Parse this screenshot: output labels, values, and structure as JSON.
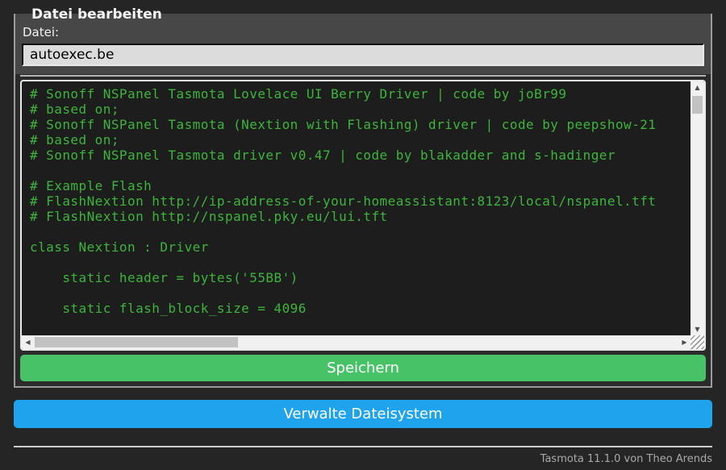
{
  "panel": {
    "legend": "Datei bearbeiten",
    "file_label": "Datei:",
    "file_value": "autoexec.be",
    "save_button": "Speichern"
  },
  "code_editor": {
    "text": "# Sonoff NSPanel Tasmota Lovelace UI Berry Driver | code by joBr99\n# based on;\n# Sonoff NSPanel Tasmota (Nextion with Flashing) driver | code by peepshow-21\n# based on;\n# Sonoff NSPanel Tasmota driver v0.47 | code by blakadder and s-hadinger\n\n# Example Flash\n# FlashNextion http://ip-address-of-your-homeassistant:8123/local/nspanel.tft\n# FlashNextion http://nspanel.pky.eu/lui.tft\n\nclass Nextion : Driver\n\n    static header = bytes('55BB')\n\n    static flash_block_size = 4096",
    "text_color": "#3db53c",
    "background": "#1d1d1d"
  },
  "icons": {
    "scroll_up": "▲",
    "scroll_down": "▼",
    "scroll_left": "◀",
    "scroll_right": "▶"
  },
  "actions": {
    "manage_filesystem": "Verwalte Dateisystem"
  },
  "footer": {
    "version": "Tasmota 11.1.0 von Theo Arends"
  },
  "colors": {
    "page_background": "#252525",
    "panel_background": "#2b2b2b",
    "file_section_background": "#474747",
    "save_button": "#47c266",
    "manage_button": "#1fa3ec"
  }
}
